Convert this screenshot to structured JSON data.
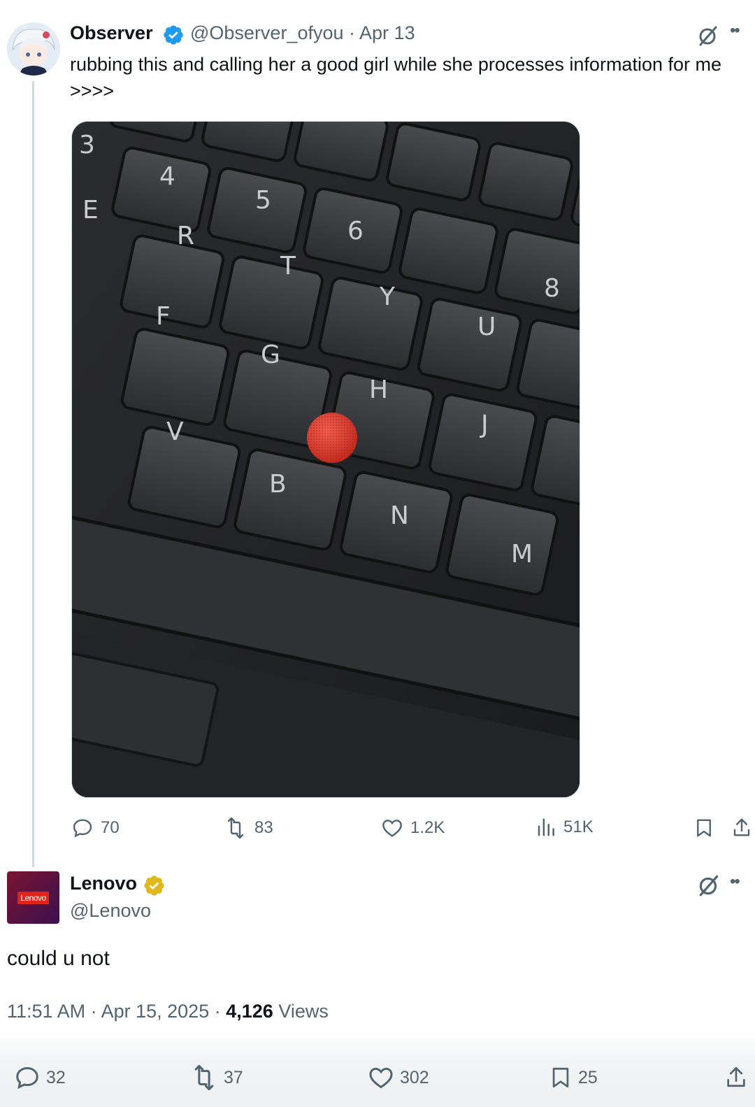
{
  "tweet": {
    "author_name": "Observer",
    "handle": "@Observer_ofyou",
    "separator": " · ",
    "date": "Apr 13",
    "text": "rubbing this and calling her a good girl while she processes information for me >>>>",
    "media_description": "photo-keyboard",
    "keycaps": [
      "3",
      "4",
      "5",
      "6",
      "E",
      "R",
      "T",
      "Y",
      "U",
      "8",
      "F",
      "G",
      "H",
      "J",
      "V",
      "B",
      "N",
      "M"
    ],
    "actions": {
      "replies": "70",
      "reposts": "83",
      "likes": "1.2K",
      "views": "51K"
    }
  },
  "reply": {
    "author_name": "Lenovo",
    "handle": "@Lenovo",
    "avatar_text": "Lenovo",
    "text": "could u not",
    "time": "11:51 AM",
    "date": "Apr 15, 2025",
    "views_count": "4,126",
    "views_label": "Views",
    "actions": {
      "replies": "32",
      "reposts": "37",
      "likes": "302",
      "bookmarks": "25"
    }
  },
  "colors": {
    "verified_blue": "#1d9bf0",
    "verified_gold": "#e2b719",
    "trackpoint_red": "#e0392b",
    "muted_text": "#536471"
  },
  "icons": [
    "grok-icon",
    "more-icon",
    "reply-icon",
    "repost-icon",
    "like-icon",
    "views-icon",
    "bookmark-icon",
    "share-icon"
  ]
}
